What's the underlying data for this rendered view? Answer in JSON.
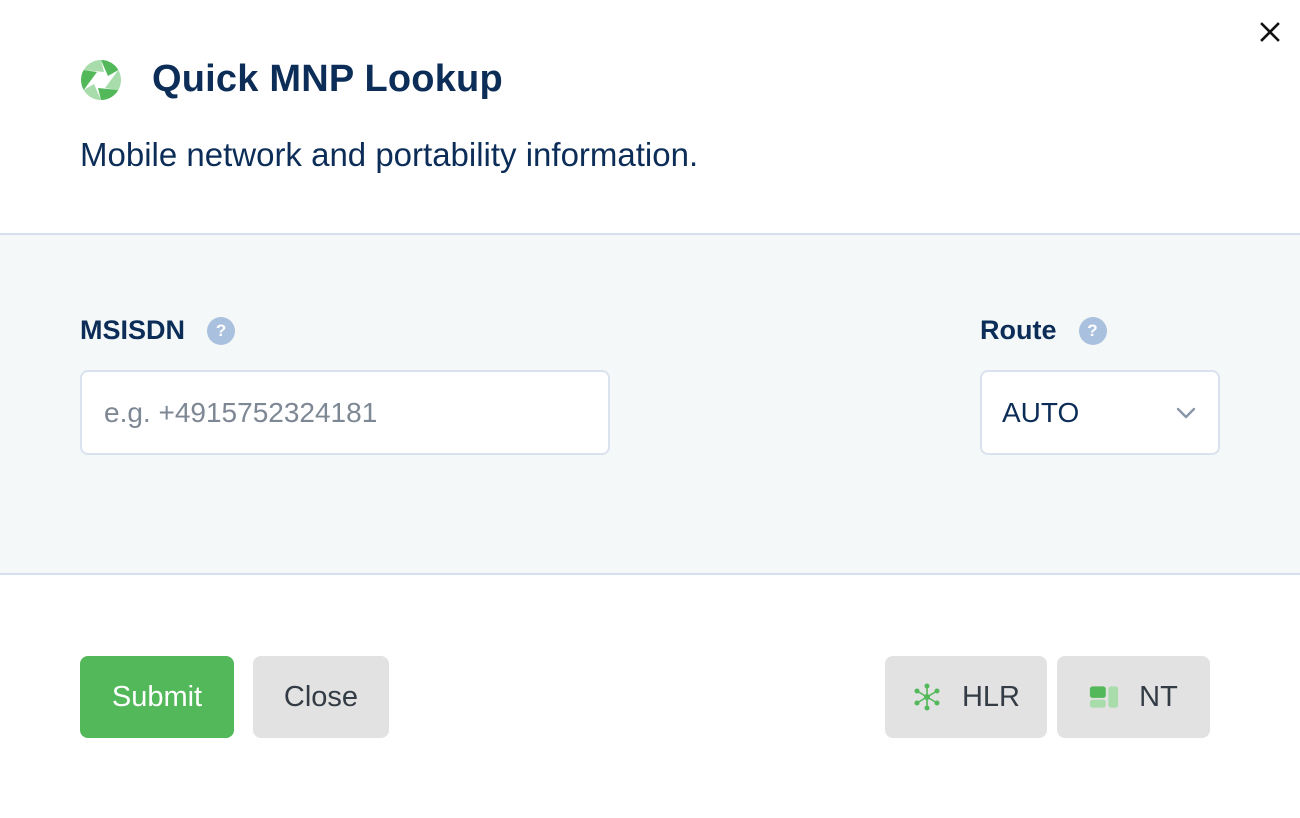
{
  "dialog": {
    "title": "Quick MNP Lookup",
    "subtitle": "Mobile network and portability information."
  },
  "form": {
    "msisdn": {
      "label": "MSISDN",
      "placeholder": "e.g. +4915752324181",
      "value": ""
    },
    "route": {
      "label": "Route",
      "selected": "AUTO"
    },
    "help_glyph": "?"
  },
  "actions": {
    "submit_label": "Submit",
    "close_label": "Close",
    "hlr_label": "HLR",
    "nt_label": "NT"
  },
  "icons": {
    "logo": "mnp-aperture-icon",
    "close": "close-icon",
    "help": "help-icon",
    "dropdown": "chevron-down-icon",
    "hlr": "network-nodes-icon",
    "nt": "number-type-blocks-icon"
  },
  "colors": {
    "brand_green": "#52b85a",
    "title_navy": "#0c2d57",
    "help_blue": "#a9c1df",
    "form_background": "#f4f8f8",
    "secondary_button": "#e2e2e2"
  }
}
